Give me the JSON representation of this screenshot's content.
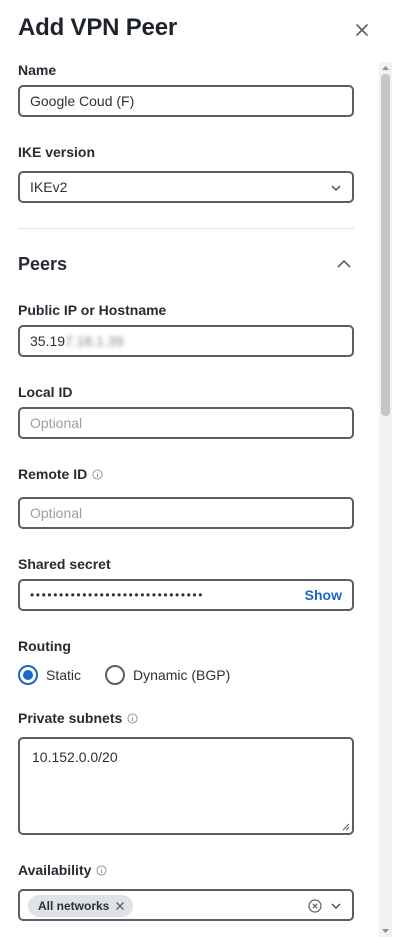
{
  "dialog": {
    "title": "Add VPN Peer"
  },
  "name": {
    "label": "Name",
    "value": "Google Coud (F)"
  },
  "ike": {
    "label": "IKE version",
    "value": "IKEv2"
  },
  "peers": {
    "section_title": "Peers",
    "public_ip": {
      "label": "Public IP or Hostname",
      "value_visible": "35.19",
      "value_obscured": "7.16.1.39"
    },
    "local_id": {
      "label": "Local ID",
      "placeholder": "Optional"
    },
    "remote_id": {
      "label": "Remote ID",
      "placeholder": "Optional"
    },
    "shared_secret": {
      "label": "Shared secret",
      "masked": "••••••••••••••••••••••••••••••",
      "show_label": "Show"
    },
    "routing": {
      "label": "Routing",
      "options": [
        "Static",
        "Dynamic (BGP)"
      ],
      "selected": "Static"
    },
    "private_subnets": {
      "label": "Private subnets",
      "value": "10.152.0.0/20"
    },
    "availability": {
      "label": "Availability",
      "chips": [
        "All networks"
      ]
    }
  },
  "colors": {
    "accent": "#1c66c7",
    "border": "#5a5f66",
    "chip_bg": "#dfe2e6"
  },
  "icons": [
    "close-icon",
    "chevron-down-icon",
    "chevron-up-icon",
    "info-icon",
    "clear-circle-icon",
    "chip-remove-icon"
  ]
}
